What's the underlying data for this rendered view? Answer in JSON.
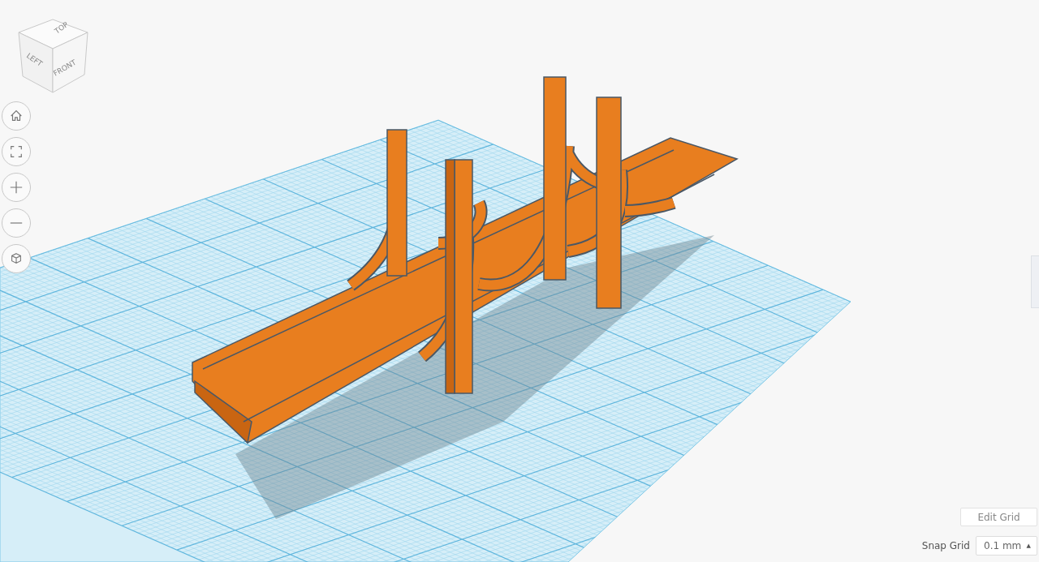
{
  "view_cube": {
    "faces": [
      "TOP",
      "LEFT",
      "FRONT"
    ]
  },
  "grid_controls": {
    "edit_button": "Edit Grid",
    "snap_label": "Snap Grid",
    "snap_value": "0.1 mm",
    "snap_caret": "▲"
  }
}
